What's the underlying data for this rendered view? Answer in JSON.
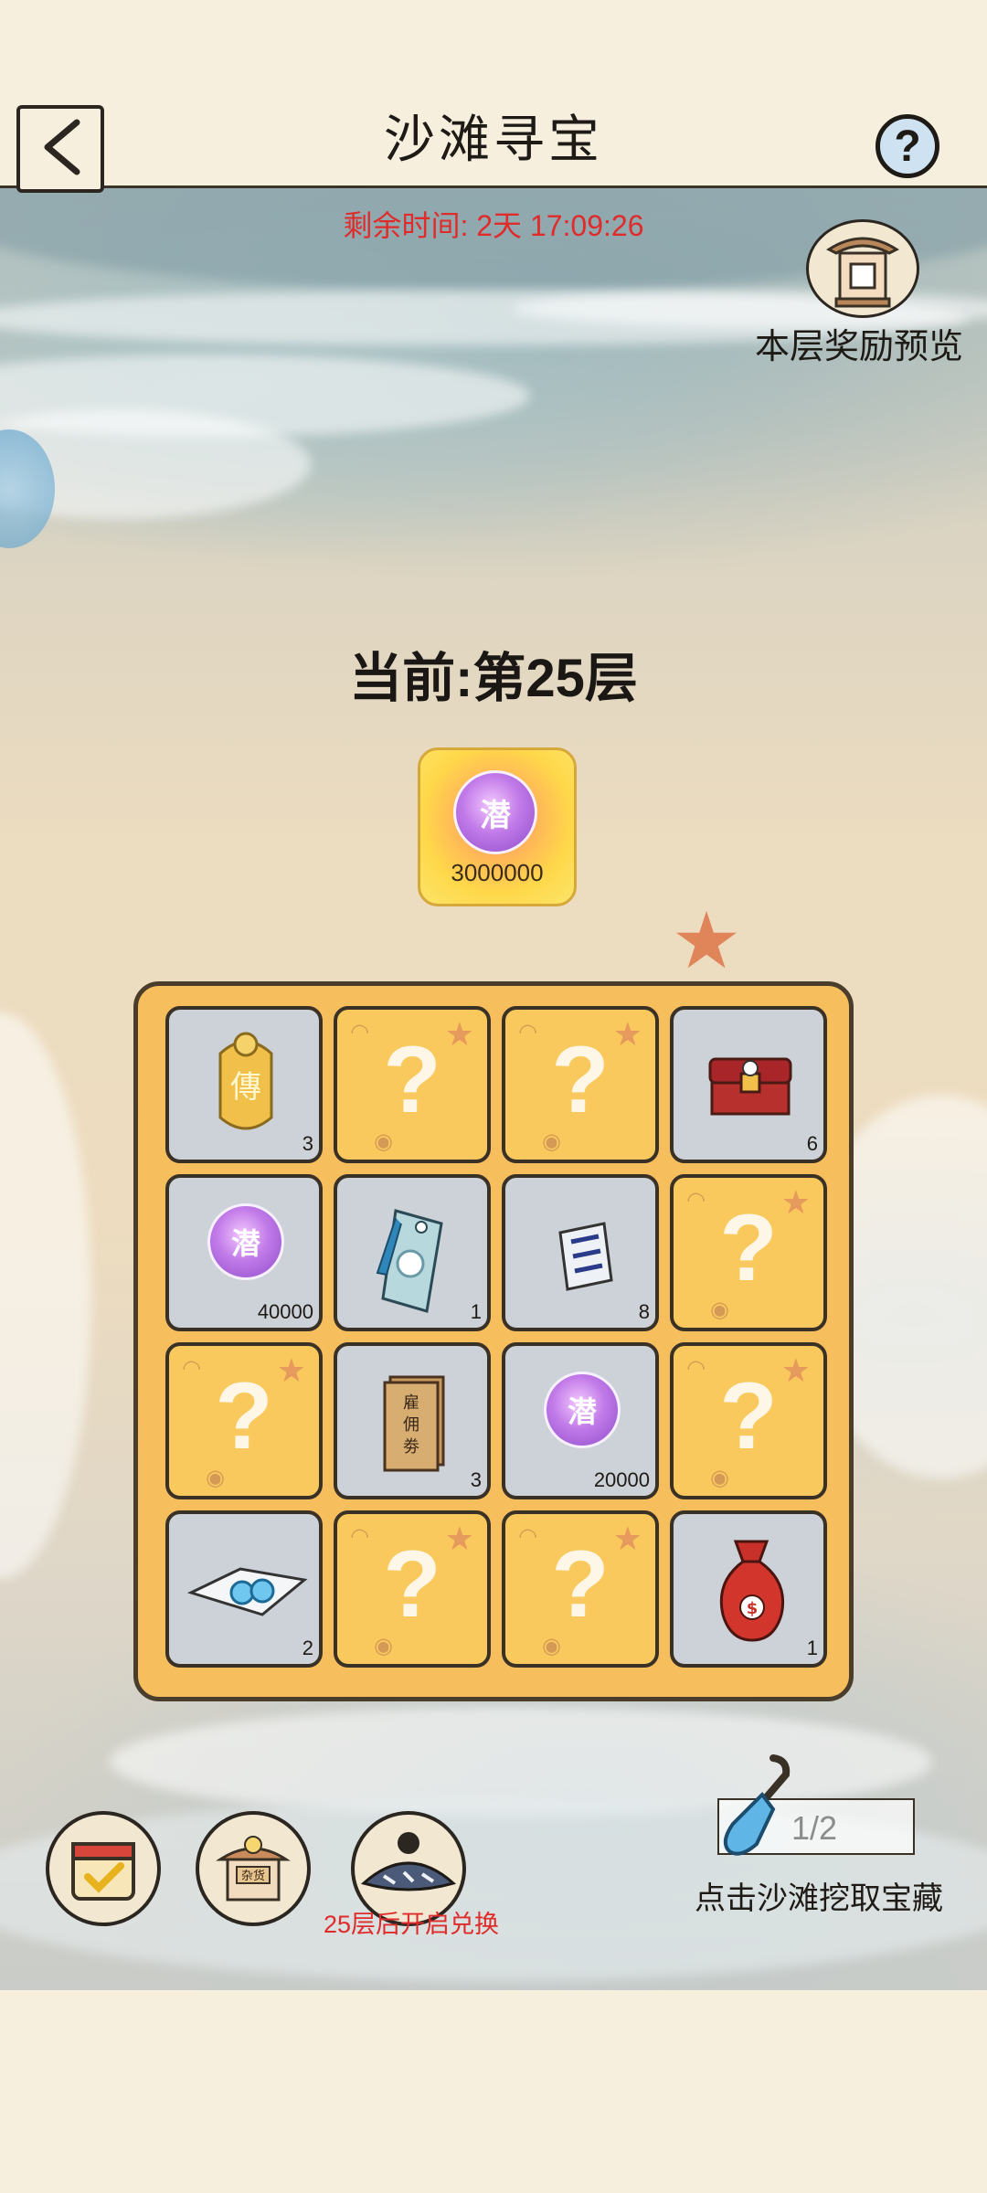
{
  "header": {
    "title": "沙滩寻宝",
    "back_icon": "back-arrow-icon",
    "help_label": "?"
  },
  "timer": {
    "text": "剩余时间: 2天 17:09:26"
  },
  "reward_preview": {
    "label": "本层奖励预览",
    "icon": "shrine-icon"
  },
  "floor": {
    "text": "当前:第25层"
  },
  "grand_reward": {
    "icon": "purple-orb-icon",
    "glyph": "潜",
    "amount": "3000000"
  },
  "board": {
    "cells": [
      {
        "state": "open",
        "item": "golden-token-icon",
        "glyph": "傳",
        "count": "3"
      },
      {
        "state": "hidden",
        "symbol": "?"
      },
      {
        "state": "hidden",
        "symbol": "?"
      },
      {
        "state": "open",
        "item": "treasure-chest-icon",
        "count": "6"
      },
      {
        "state": "open",
        "item": "purple-orb-icon",
        "glyph": "潜",
        "count": "40000"
      },
      {
        "state": "open",
        "item": "blue-tag-icon",
        "count": "1"
      },
      {
        "state": "open",
        "item": "scroll-icon",
        "count": "8"
      },
      {
        "state": "hidden",
        "symbol": "?"
      },
      {
        "state": "hidden",
        "symbol": "?"
      },
      {
        "state": "open",
        "item": "hire-ticket-icon",
        "glyph": "雇佣劵",
        "count": "3"
      },
      {
        "state": "open",
        "item": "purple-orb-icon",
        "glyph": "潜",
        "count": "20000"
      },
      {
        "state": "hidden",
        "symbol": "?"
      },
      {
        "state": "open",
        "item": "pearl-cloth-icon",
        "count": "2"
      },
      {
        "state": "hidden",
        "symbol": "?"
      },
      {
        "state": "hidden",
        "symbol": "?"
      },
      {
        "state": "open",
        "item": "money-bag-icon",
        "count": "1"
      }
    ]
  },
  "bottom": {
    "calendar_icon": "calendar-check-icon",
    "shop_icon": "general-store-icon",
    "shop_sign": "杂货",
    "exchange_icon": "straw-hat-npc-icon",
    "exchange_note": "25层后开启兑换",
    "shovel_icon": "shovel-icon",
    "shovel_count": "1/2",
    "dig_label": "点击沙滩挖取宝藏"
  },
  "colors": {
    "accent_red": "#e02b2b",
    "board_bg": "#f7be5e",
    "hidden_cell": "#f9c95e",
    "open_cell": "#ccd2d8"
  }
}
